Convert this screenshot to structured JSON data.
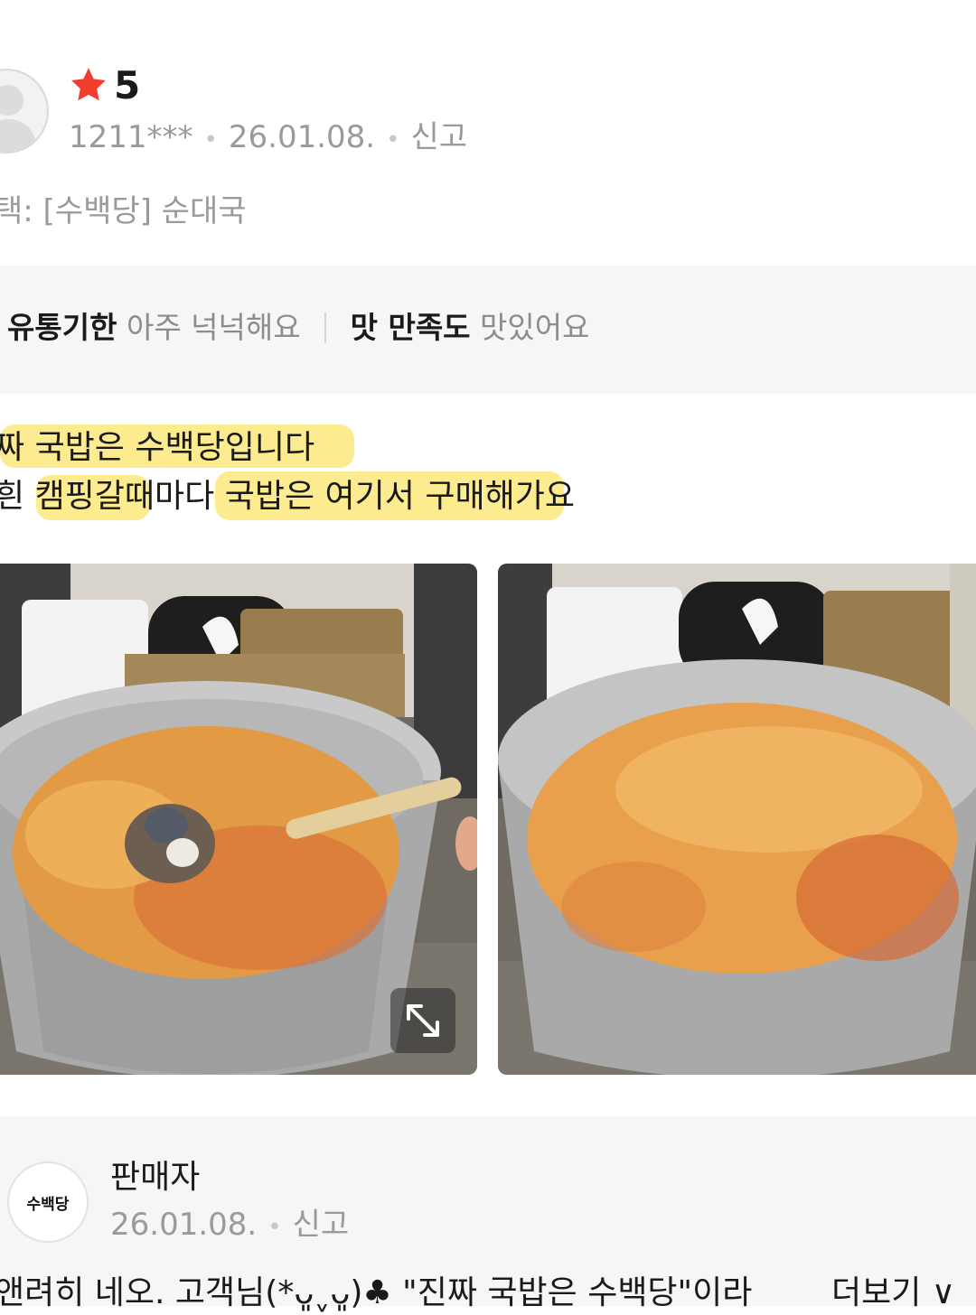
{
  "review": {
    "rating": "5",
    "user_id": "1211***",
    "date": "26.01.08.",
    "report_label": "신고",
    "option_text": "택: [수백당] 순대국",
    "survey": [
      {
        "label": "유통기한",
        "value": "아주 넉넉해요"
      },
      {
        "label": "맛 만족도",
        "value": "맛있어요"
      }
    ],
    "body_lines": [
      "짜 국밥은 수백당입니다",
      "흰 캠핑갈때마다 국밥은 여기서 구매해가요"
    ]
  },
  "seller": {
    "logo_text": "수백당",
    "name": "판매자",
    "date": "26.01.08.",
    "report_label": "신고",
    "reply_preview": "앤려히 네오. 고객님(*ᴗ͈ˬᴗ͈)♣ \"진짜 국밥은 수백당\"이라",
    "more_label": "더보기 ∨"
  },
  "colors": {
    "star": "#f23c2e",
    "highlight": "#fbe46a",
    "muted_text": "#9a9a9a",
    "panel_bg": "#f5f6f8"
  }
}
